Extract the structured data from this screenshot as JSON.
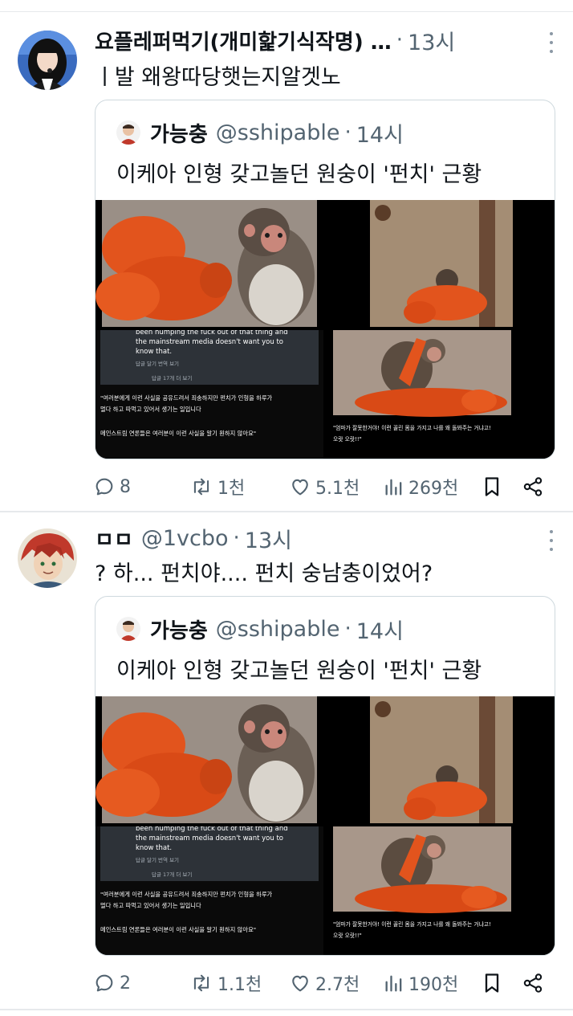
{
  "posts": [
    {
      "author_name": "요플레퍼먹기(개미핥기식작명) …",
      "time": "13시",
      "text": "ㅣ발 왜왕따당햇는지알겟노",
      "quote": {
        "name": "가능충",
        "handle": "@sshipable",
        "time": "14시",
        "text": "이케아 인형 갖고놀던 원숭이 '펀치' 근황"
      },
      "actions": {
        "replies": "8",
        "reposts": "1천",
        "likes": "5.1천",
        "views": "269천"
      }
    },
    {
      "author_name": "ㅁㅁ",
      "handle": "@1vcbo",
      "time": "13시",
      "text": "? 하... 펀치야.... 펀치 숭남충이었어?",
      "quote": {
        "name": "가능충",
        "handle": "@sshipable",
        "time": "14시",
        "text": "이케아 인형 갖고놀던 원숭이 '펀치' 근황"
      },
      "actions": {
        "replies": "2",
        "reposts": "1.1천",
        "likes": "2.7천",
        "views": "190천"
      }
    }
  ],
  "media_captions": {
    "english_1": "been humping the fuck out of that thing and",
    "english_2": "the mainstream media doesn't want you to",
    "english_3": "know that.",
    "reply_links": "답글 달기      번역 보기",
    "more_replies": "답글 17개 더 보기",
    "ko_1": "\"여러분에게 이런 사실을 공유드려서 죄송하지만 펀치가 인형을 하루가",
    "ko_2": "멀다 하고 따먹고 있어서 생기는 일입니다",
    "ko_3": "메인스트림 연론들은 여러분이 이런 사실을 알기 원하지 않아요\"",
    "right_1": "\"엄마가 잘못한거야! 이런 꼴린 몸을 가지고 나를 왜 돌봐주는 거냐고!",
    "right_2": "오랏 오랏!!\""
  },
  "colors": {
    "text": "#0f1419",
    "muted": "#536471",
    "border": "#cfd9de",
    "toy": "#e2541d"
  },
  "icons": [
    "more-icon",
    "reply-icon",
    "repost-icon",
    "like-icon",
    "views-icon",
    "bookmark-icon",
    "share-icon"
  ]
}
